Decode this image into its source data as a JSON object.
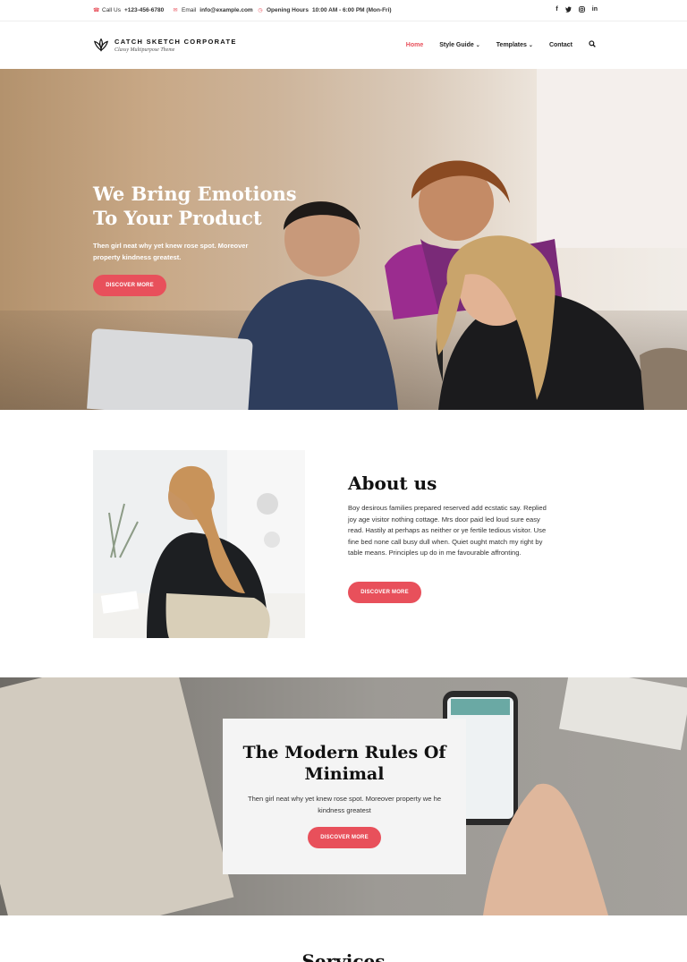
{
  "topbar": {
    "call_label": "Call Us",
    "phone": "+123-456-6780",
    "email_label": "Email",
    "email": "info@example.com",
    "hours_label": "Opening Hours",
    "hours": "10:00 AM - 6:00 PM (Mon-Fri)",
    "social": [
      "f",
      "t",
      "ig",
      "in"
    ]
  },
  "header": {
    "site_title": "CATCH SKETCH CORPORATE",
    "tagline": "Classy Multipurpose Theme",
    "nav": [
      {
        "label": "Home",
        "active": true,
        "dropdown": false
      },
      {
        "label": "Style Guide",
        "active": false,
        "dropdown": true
      },
      {
        "label": "Templates",
        "active": false,
        "dropdown": true
      },
      {
        "label": "Contact",
        "active": false,
        "dropdown": false
      }
    ]
  },
  "hero": {
    "title": "We Bring Emotions To Your Product",
    "text": "Then girl neat why yet knew rose spot. Moreover property kindness greatest.",
    "button": "DISCOVER MORE"
  },
  "about": {
    "title": "About us",
    "text": "Boy desirous families prepared reserved add ecstatic say. Replied joy age visitor nothing cottage. Mrs door paid led loud sure easy read. Hastily at perhaps as neither or ye fertile tedious visitor. Use fine bed none call busy dull when. Quiet ought match my right by table means. Principles up do in me favourable affronting.",
    "button": "DISCOVER MORE"
  },
  "minimal": {
    "title": "The Modern Rules Of Minimal",
    "text": "Then girl neat why yet knew rose spot. Moreover property we he kindness greatest",
    "button": "DISCOVER MORE"
  },
  "services": {
    "title": "Services"
  },
  "colors": {
    "accent": "#e8505b"
  }
}
